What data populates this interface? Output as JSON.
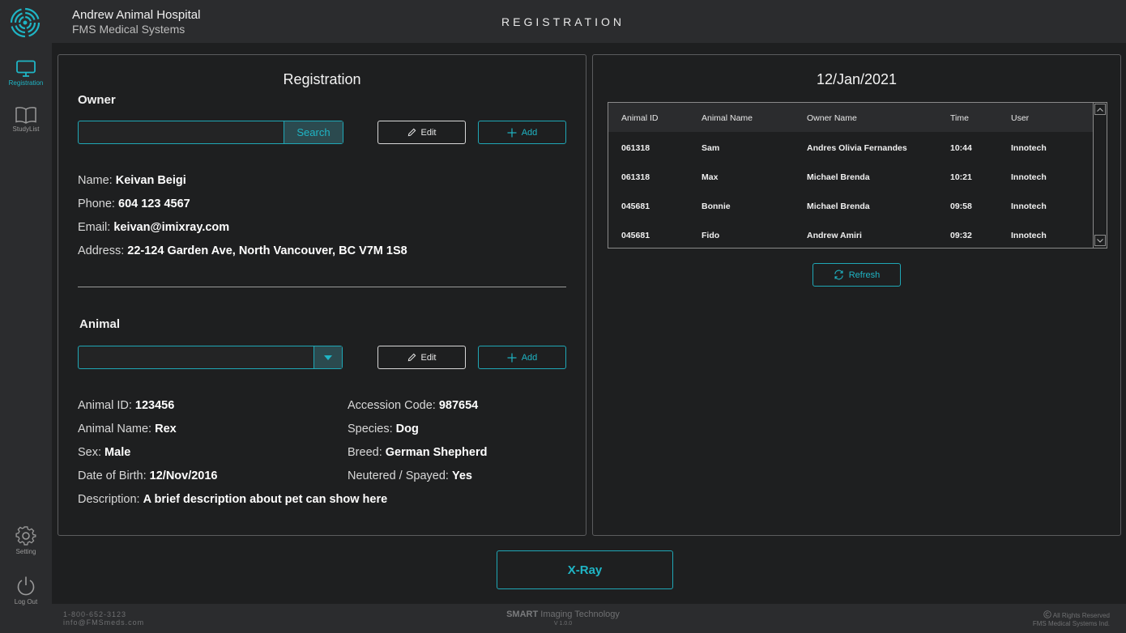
{
  "header": {
    "hospital": "Andrew Animal Hospital",
    "company": "FMS Medical Systems",
    "page_title": "REGISTRATION"
  },
  "sidebar": {
    "items": [
      {
        "label": "Registration",
        "icon": "monitor-icon",
        "active": true
      },
      {
        "label": "StudyList",
        "icon": "book-icon",
        "active": false
      },
      {
        "label": "Setting",
        "icon": "gear-icon",
        "active": false
      },
      {
        "label": "Log Out",
        "icon": "power-icon",
        "active": false
      }
    ]
  },
  "registration": {
    "title": "Registration",
    "owner_section": "Owner",
    "search_value": "",
    "search_label": "Search",
    "edit_label": "Edit",
    "add_label": "Add",
    "owner": {
      "name_label": "Name:",
      "name": "Keivan Beigi",
      "phone_label": "Phone:",
      "phone": "604 123 4567",
      "email_label": "Email:",
      "email": "keivan@imixray.com",
      "address_label": "Address:",
      "address": "22-124 Garden Ave, North Vancouver, BC V7M 1S8"
    },
    "animal_section": "Animal",
    "animal_select_value": "",
    "animal": {
      "id_label": "Animal ID:",
      "id": "123456",
      "name_label": "Animal Name:",
      "name": "Rex",
      "sex_label": "Sex:",
      "sex": "Male",
      "dob_label": "Date of Birth:",
      "dob": "12/Nov/2016",
      "accession_label": "Accession Code:",
      "accession": "987654",
      "species_label": "Species:",
      "species": "Dog",
      "breed_label": "Breed:",
      "breed": "German Shepherd",
      "neutered_label": "Neutered / Spayed:",
      "neutered": "Yes",
      "description_label": "Description:",
      "description": "A brief description about pet can show here"
    }
  },
  "list": {
    "date": "12/Jan/2021",
    "columns": [
      "Animal ID",
      "Animal Name",
      "Owner Name",
      "Time",
      "User"
    ],
    "rows": [
      [
        "061318",
        "Sam",
        "Andres Olivia Fernandes",
        "10:44",
        "Innotech"
      ],
      [
        "061318",
        "Max",
        "Michael Brenda",
        "10:21",
        "Innotech"
      ],
      [
        "045681",
        "Bonnie",
        "Michael Brenda",
        "09:58",
        "Innotech"
      ],
      [
        "045681",
        "Fido",
        "Andrew Amiri",
        "09:32",
        "Innotech"
      ]
    ],
    "refresh_label": "Refresh"
  },
  "xray_label": "X-Ray",
  "footer": {
    "phone": "1-800-652-3123",
    "email": "info@FMSmeds.com",
    "brand_bold": "SMART",
    "brand_rest": " Imaging Technology",
    "version": "V 1.0.0",
    "rights": "All Rights Reserved",
    "company": "FMS Medical Systems Ind."
  },
  "colors": {
    "accent": "#1fb5c5",
    "background": "#1e1f20",
    "bar": "#2b2c2e"
  }
}
